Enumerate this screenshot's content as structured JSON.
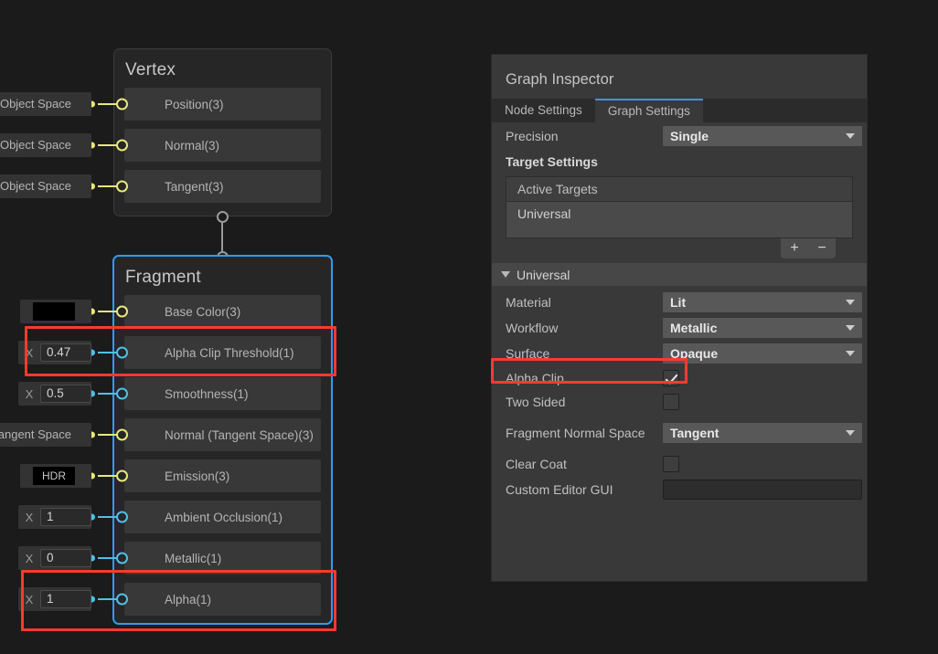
{
  "graph": {
    "vertex_node": {
      "title": "Vertex",
      "ports": [
        {
          "label": "Position(3)",
          "slot_type": "dropdown",
          "slot_value": "Object Space",
          "port_color": "vector"
        },
        {
          "label": "Normal(3)",
          "slot_type": "dropdown",
          "slot_value": "Object Space",
          "port_color": "vector"
        },
        {
          "label": "Tangent(3)",
          "slot_type": "dropdown",
          "slot_value": "Object Space",
          "port_color": "vector"
        }
      ]
    },
    "fragment_node": {
      "title": "Fragment",
      "ports": [
        {
          "label": "Base Color(3)",
          "slot_type": "color",
          "slot_value": "",
          "port_color": "vector"
        },
        {
          "label": "Alpha Clip Threshold(1)",
          "slot_type": "float",
          "slot_value": "0.47",
          "axis": "X",
          "port_color": "float"
        },
        {
          "label": "Smoothness(1)",
          "slot_type": "float",
          "slot_value": "0.5",
          "axis": "X",
          "port_color": "float"
        },
        {
          "label": "Normal (Tangent Space)(3)",
          "slot_type": "dropdown",
          "slot_value": "Tangent Space",
          "port_color": "vector"
        },
        {
          "label": "Emission(3)",
          "slot_type": "color",
          "slot_value": "HDR",
          "port_color": "vector"
        },
        {
          "label": "Ambient Occlusion(1)",
          "slot_type": "float",
          "slot_value": "1",
          "axis": "X",
          "port_color": "float"
        },
        {
          "label": "Metallic(1)",
          "slot_type": "float",
          "slot_value": "0",
          "axis": "X",
          "port_color": "float"
        },
        {
          "label": "Alpha(1)",
          "slot_type": "float",
          "slot_value": "1",
          "axis": "X",
          "port_color": "float"
        }
      ]
    },
    "colors": {
      "vector_port": "#e8e87a",
      "float_port": "#4ec0e8",
      "selection_border": "#2e9cf0",
      "annotation": "#f83b2e"
    }
  },
  "inspector": {
    "title": "Graph Inspector",
    "tabs": [
      {
        "label": "Node Settings",
        "active": false
      },
      {
        "label": "Graph Settings",
        "active": true
      }
    ],
    "precision": {
      "label": "Precision",
      "value": "Single"
    },
    "target_settings": {
      "heading": "Target Settings",
      "list_header": "Active Targets",
      "items": [
        "Universal"
      ],
      "add_button": "+",
      "remove_button": "−"
    },
    "universal": {
      "section_label": "Universal",
      "rows": [
        {
          "label": "Material",
          "type": "dropdown",
          "value": "Lit"
        },
        {
          "label": "Workflow",
          "type": "dropdown",
          "value": "Metallic"
        },
        {
          "label": "Surface",
          "type": "dropdown",
          "value": "Opaque"
        },
        {
          "label": "Alpha Clip",
          "type": "checkbox",
          "value": "checked"
        },
        {
          "label": "Two Sided",
          "type": "checkbox",
          "value": "unchecked"
        },
        {
          "label": "Fragment Normal Space",
          "type": "dropdown",
          "value": "Tangent"
        },
        {
          "label": "Clear Coat",
          "type": "checkbox",
          "value": "unchecked"
        },
        {
          "label": "Custom Editor GUI",
          "type": "text",
          "value": ""
        }
      ]
    }
  }
}
